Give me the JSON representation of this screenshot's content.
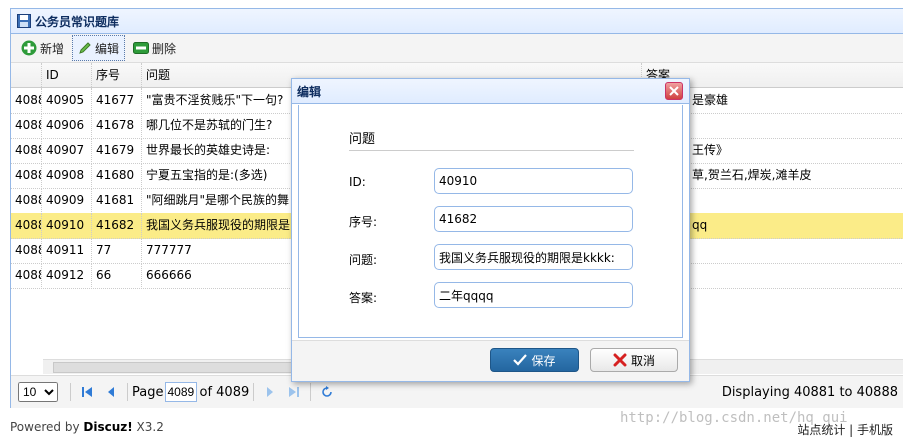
{
  "panel": {
    "title": "公务员常识题库"
  },
  "toolbar": {
    "add_label": "新增",
    "edit_label": "编辑",
    "delete_label": "删除"
  },
  "grid": {
    "columns": [
      "ID",
      "序号",
      "问题",
      "答案"
    ],
    "rows": [
      {
        "rownum": "4088",
        "id": "40905",
        "seq": "41677",
        "question": "\"富贵不淫贫贱乐\"下一句?",
        "answer": "是豪雄"
      },
      {
        "rownum": "4088",
        "id": "40906",
        "seq": "41678",
        "question": "哪几位不是苏轼的门生?",
        "answer": ""
      },
      {
        "rownum": "4088",
        "id": "40907",
        "seq": "41679",
        "question": "世界最长的英雄史诗是:",
        "answer": "王传》"
      },
      {
        "rownum": "4088",
        "id": "40908",
        "seq": "41680",
        "question": "宁夏五宝指的是:(多选)",
        "answer": "草,贺兰石,焊炭,滩羊皮"
      },
      {
        "rownum": "4088",
        "id": "40909",
        "seq": "41681",
        "question": "\"阿细跳月\"是哪个民族的舞",
        "answer": ""
      },
      {
        "rownum": "4088",
        "id": "40910",
        "seq": "41682",
        "question": "我国义务兵服现役的期限是",
        "answer": "qq",
        "selected": true
      },
      {
        "rownum": "4088",
        "id": "40911",
        "seq": "77",
        "question": "777777",
        "answer": ""
      },
      {
        "rownum": "4088",
        "id": "40912",
        "seq": "66",
        "question": "666666",
        "answer": ""
      }
    ]
  },
  "pager": {
    "page_size": "10",
    "page_label": "Page",
    "page_value": "4089",
    "of_label": "of 4089",
    "display_text": "Displaying 40881 to 40888"
  },
  "dialog": {
    "title": "编辑",
    "form_title": "问题",
    "fields": {
      "id_label": "ID:",
      "id_value": "40910",
      "seq_label": "序号:",
      "seq_value": "41682",
      "question_label": "问题:",
      "question_value": "我国义务兵服现役的期限是kkkk:",
      "answer_label": "答案:",
      "answer_value": "二年qqqq"
    },
    "save_label": "保存",
    "cancel_label": "取消"
  },
  "footer": {
    "powered_prefix": "Powered by ",
    "powered_brand": "Discuz!",
    "powered_version": " X3.2",
    "right_text": "站点统计 | 手机版",
    "watermark": "http://blog.csdn.net/hq_qui"
  },
  "colors": {
    "accent": "#95b8e7",
    "selected_row": "#fbec88",
    "save_button": "#2466a0"
  }
}
